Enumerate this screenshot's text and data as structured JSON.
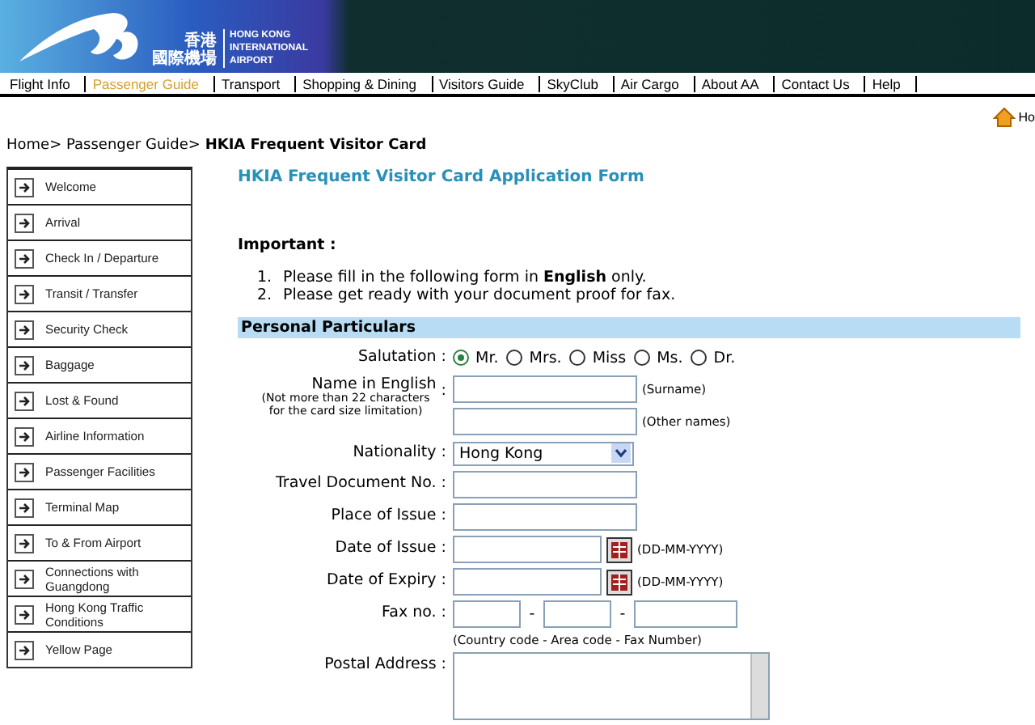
{
  "header": {
    "logo_chinese_top": "香港",
    "logo_chinese_bottom": "國際機場",
    "logo_english": [
      "HONG KONG",
      "INTERNATIONAL",
      "AIRPORT"
    ]
  },
  "nav": [
    {
      "label": "Flight Info",
      "selected": false
    },
    {
      "label": "Passenger Guide",
      "selected": true
    },
    {
      "label": "Transport",
      "selected": false
    },
    {
      "label": "Shopping & Dining",
      "selected": false
    },
    {
      "label": "Visitors Guide",
      "selected": false
    },
    {
      "label": "SkyClub",
      "selected": false
    },
    {
      "label": "Air Cargo",
      "selected": false
    },
    {
      "label": "About AA",
      "selected": false
    },
    {
      "label": "Contact Us",
      "selected": false
    },
    {
      "label": "Help",
      "selected": false
    }
  ],
  "home_link": "Ho",
  "breadcrumb": [
    {
      "label": "Home",
      "current": false
    },
    {
      "label": "Passenger Guide",
      "current": false
    },
    {
      "label": "HKIA Frequent Visitor Card",
      "current": true
    }
  ],
  "breadcrumb_separator": ">",
  "sidebar": {
    "items": [
      "Welcome",
      "Arrival",
      "Check In / Departure",
      "Transit / Transfer",
      "Security Check",
      "Baggage",
      "Lost & Found",
      "Airline Information",
      "Passenger Facilities",
      "Terminal Map",
      "To & From Airport",
      "Connections with Guangdong",
      "Hong Kong Traffic Conditions",
      "Yellow Page"
    ]
  },
  "form": {
    "title": "HKIA Frequent Visitor Card Application Form",
    "important_heading": "Important :",
    "instructions": [
      {
        "number": "1.",
        "text": "Please fill in the following form in **English** only."
      },
      {
        "number": "2.",
        "text": "Please get ready with your document proof for fax."
      }
    ],
    "section": "Personal Particulars",
    "rows": [
      {
        "kind": "radio",
        "label": "Salutation :",
        "options": [
          {
            "label": "Mr.",
            "selected": true
          },
          {
            "label": "Mrs.",
            "selected": false
          },
          {
            "label": "Miss",
            "selected": false
          },
          {
            "label": "Ms.",
            "selected": false
          },
          {
            "label": "Dr.",
            "selected": false
          }
        ]
      },
      {
        "kind": "name",
        "label": "Name in English",
        "note": "(Not more than 22 characters for the card size limitation)",
        "separator": ":",
        "hints": [
          "(Surname)",
          "(Other names)"
        ]
      },
      {
        "kind": "select",
        "label": "Nationality :",
        "value": "Hong Kong"
      },
      {
        "kind": "text",
        "label": "Travel Document No. :"
      },
      {
        "kind": "text",
        "label": "Place of Issue :"
      },
      {
        "kind": "date",
        "label": "Date of Issue :",
        "hint": "(DD-MM-YYYY)"
      },
      {
        "kind": "date",
        "label": "Date of Expiry :",
        "hint": "(DD-MM-YYYY)"
      },
      {
        "kind": "fax",
        "label": "Fax no. :",
        "dash": "-",
        "hint": "(Country code - Area code - Fax Number)"
      },
      {
        "kind": "textarea",
        "label": "Postal Address :"
      }
    ]
  }
}
